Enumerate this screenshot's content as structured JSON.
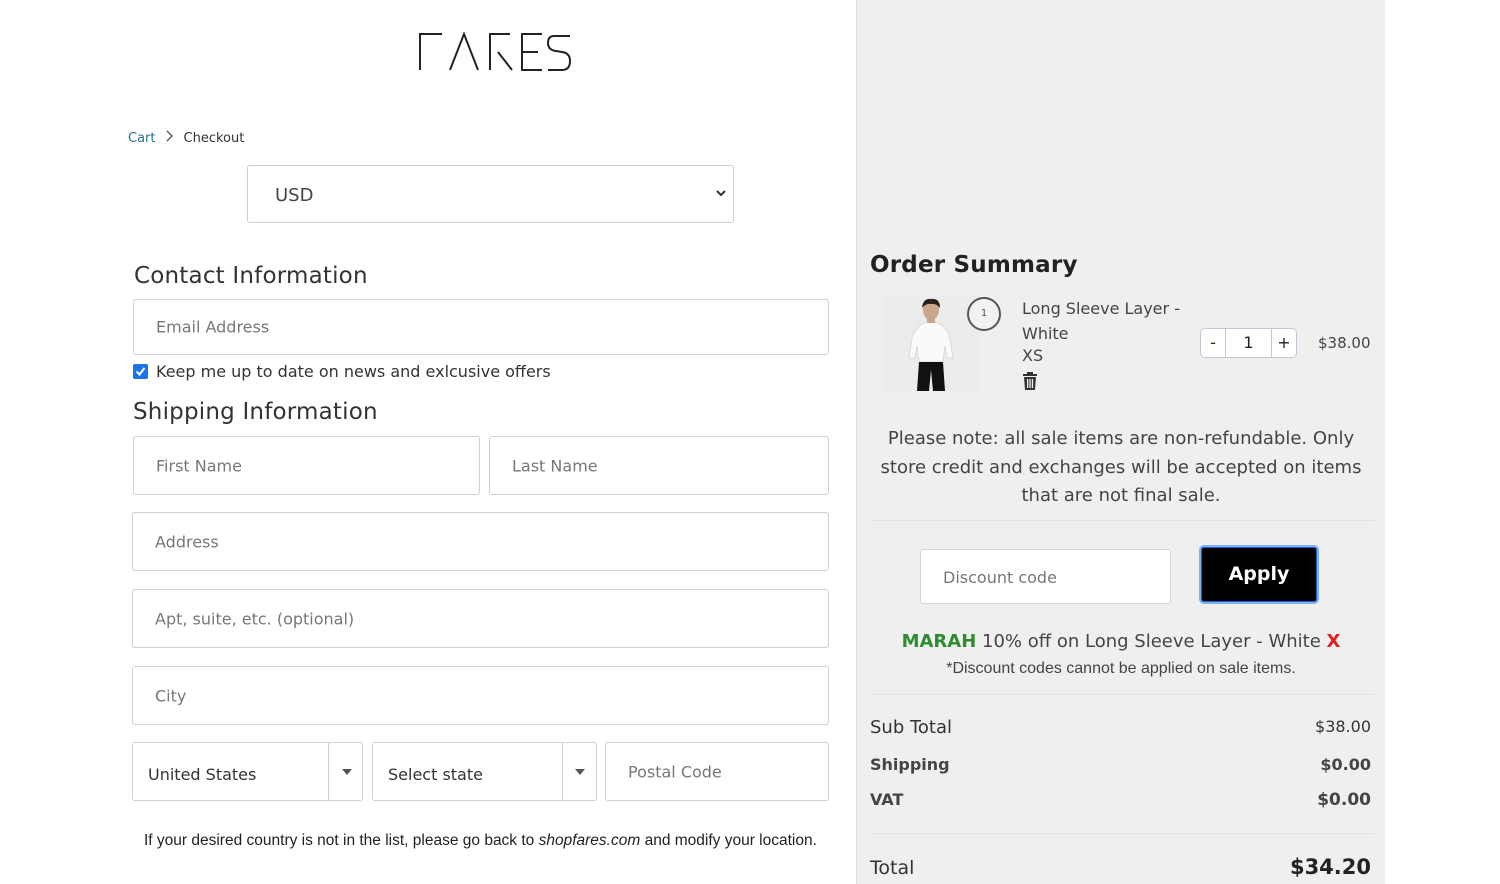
{
  "brand": {
    "logo_text": "FARES"
  },
  "breadcrumb": {
    "cart": "Cart",
    "separator_icon": "chevron-right-icon",
    "current": "Checkout"
  },
  "currency": {
    "selected": "USD",
    "icon": "chevron-down-icon"
  },
  "contact": {
    "heading": "Contact Information",
    "email_placeholder": "Email Address",
    "newsletter_label": "Keep me up to date on news and exlcusive offers",
    "newsletter_checked": true
  },
  "shipping": {
    "heading": "Shipping Information",
    "first_name_placeholder": "First Name",
    "last_name_placeholder": "Last Name",
    "address_placeholder": "Address",
    "apt_placeholder": "Apt, suite, etc. (optional)",
    "city_placeholder": "City",
    "country_selected": "United States",
    "state_selected": "Select state",
    "postal_placeholder": "Postal Code",
    "country_note_before": "If your desired country is not in the list, please go back to ",
    "country_note_link": "shopfares.com",
    "country_note_after": " and modify your location."
  },
  "summary": {
    "heading": "Order Summary",
    "item": {
      "name": "Long Sleeve Layer - White",
      "variant": "XS",
      "badge_count": "1",
      "quantity": "1",
      "minus": "-",
      "plus": "+",
      "price": "$38.00"
    },
    "sale_note": "Please note: all sale items are non-refundable. Only store credit and exchanges will be accepted on items that are not final sale.",
    "discount_placeholder": "Discount code",
    "apply_label": "Apply",
    "applied_code": "MARAH",
    "applied_desc": " 10% off on Long Sleeve Layer - White ",
    "remove_label": "X",
    "discount_note": "*Discount codes cannot be applied on sale items.",
    "subtotal_label": "Sub Total",
    "subtotal_value": "$38.00",
    "shipping_label": "Shipping",
    "shipping_value": "$0.00",
    "vat_label": "VAT",
    "vat_value": "$0.00",
    "total_label": "Total",
    "total_value": "$34.20"
  },
  "colors": {
    "accent": "#1a73e8",
    "discount_code": "#2e8b2e",
    "remove": "#e02020",
    "panel_bg": "#efefef"
  }
}
